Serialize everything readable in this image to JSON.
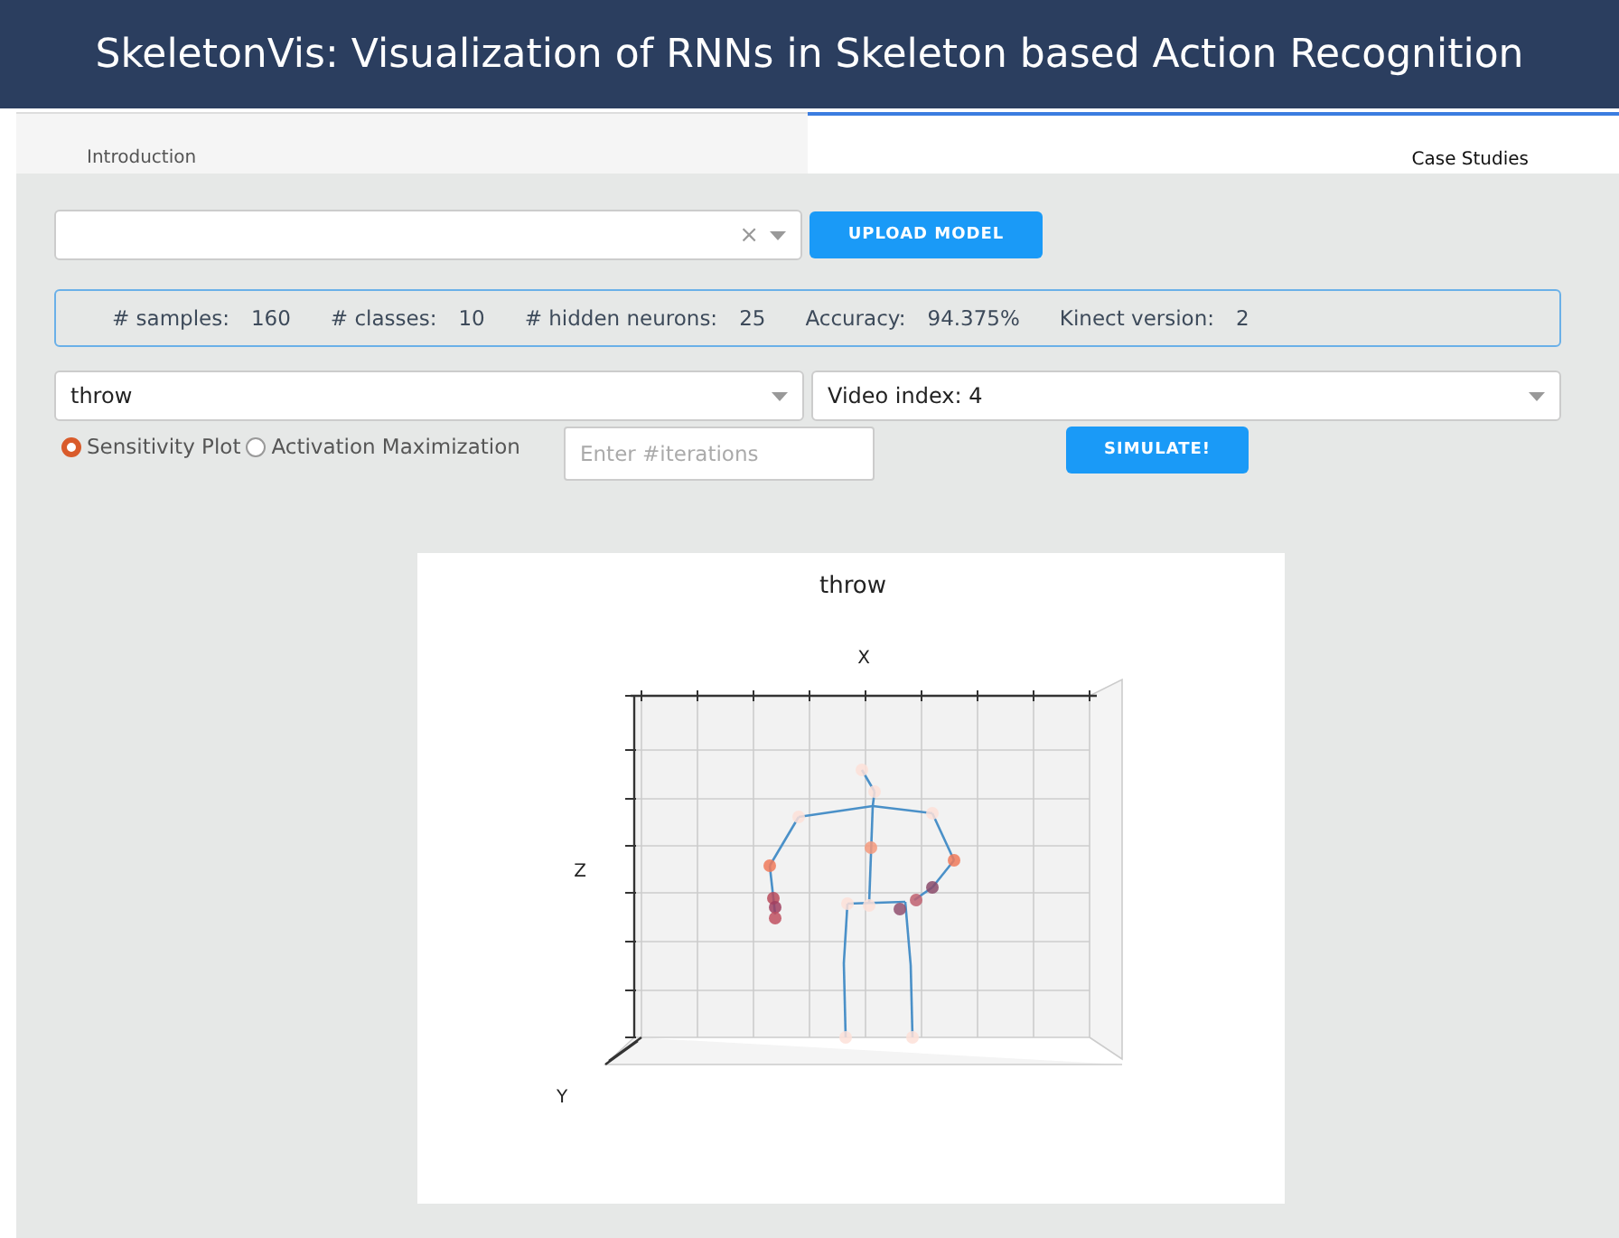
{
  "header": {
    "title": "SkeletonVis: Visualization of RNNs in Skeleton based Action Recognition"
  },
  "tabs": [
    {
      "label": "Introduction",
      "selected": false
    },
    {
      "label": "Case Studies",
      "selected": true
    }
  ],
  "model_select": {
    "clear": "×"
  },
  "upload_button": "UPLOAD MODEL",
  "stats": [
    {
      "label": "# samples:",
      "value": "160"
    },
    {
      "label": "# classes:",
      "value": "10"
    },
    {
      "label": "# hidden neurons:",
      "value": "25"
    },
    {
      "label": "Accuracy:",
      "value": "94.375%"
    },
    {
      "label": "Kinect version:",
      "value": "2"
    }
  ],
  "action_select": {
    "value": "throw"
  },
  "video_select": {
    "value": "Video index: 4"
  },
  "modes": [
    {
      "label": "Sensitivity Plot",
      "selected": true
    },
    {
      "label": "Activation Maximization",
      "selected": false
    }
  ],
  "iterations": {
    "placeholder": "Enter #iterations"
  },
  "simulate_button": "SIMULATE!",
  "plot": {
    "title": "throw",
    "x_axis": "X",
    "z_axis": "Z",
    "y_axis": "Y"
  }
}
